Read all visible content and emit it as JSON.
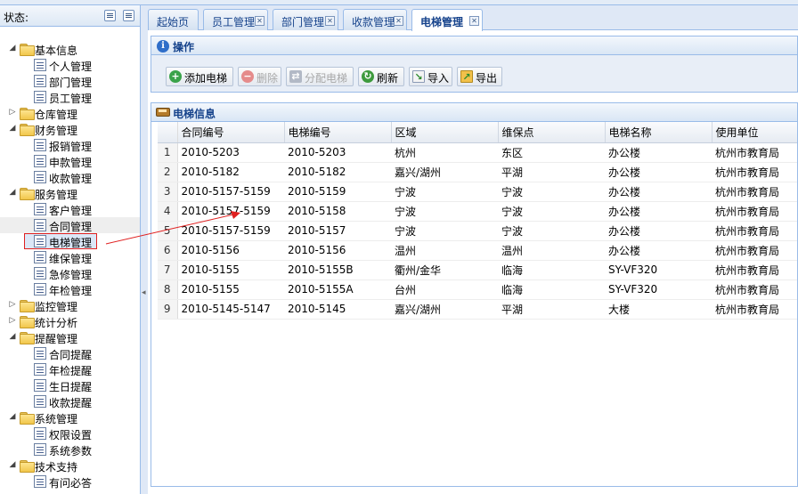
{
  "left_panel": {
    "title": "状态:"
  },
  "tree": [
    {
      "label": "基本信息",
      "level": 0,
      "expanded": true
    },
    {
      "label": "个人管理",
      "level": 1
    },
    {
      "label": "部门管理",
      "level": 1
    },
    {
      "label": "员工管理",
      "level": 1
    },
    {
      "label": "仓库管理",
      "level": 0,
      "expanded": false
    },
    {
      "label": "财务管理",
      "level": 0,
      "expanded": true
    },
    {
      "label": "报销管理",
      "level": 1
    },
    {
      "label": "申款管理",
      "level": 1
    },
    {
      "label": "收款管理",
      "level": 1
    },
    {
      "label": "服务管理",
      "level": 0,
      "expanded": true
    },
    {
      "label": "客户管理",
      "level": 1
    },
    {
      "label": "合同管理",
      "level": 1
    },
    {
      "label": "电梯管理",
      "level": 1,
      "selected": true
    },
    {
      "label": "维保管理",
      "level": 1
    },
    {
      "label": "急修管理",
      "level": 1
    },
    {
      "label": "年检管理",
      "level": 1
    },
    {
      "label": "监控管理",
      "level": 0,
      "expanded": false
    },
    {
      "label": "统计分析",
      "level": 0,
      "expanded": false
    },
    {
      "label": "提醒管理",
      "level": 0,
      "expanded": true
    },
    {
      "label": "合同提醒",
      "level": 1
    },
    {
      "label": "年检提醒",
      "level": 1
    },
    {
      "label": "生日提醒",
      "level": 1
    },
    {
      "label": "收款提醒",
      "level": 1
    },
    {
      "label": "系统管理",
      "level": 0,
      "expanded": true
    },
    {
      "label": "权限设置",
      "level": 1
    },
    {
      "label": "系统参数",
      "level": 1
    },
    {
      "label": "技术支持",
      "level": 0,
      "expanded": true
    },
    {
      "label": "有问必答",
      "level": 1
    }
  ],
  "tabs": [
    {
      "label": "起始页",
      "closable": false
    },
    {
      "label": "员工管理",
      "closable": true
    },
    {
      "label": "部门管理",
      "closable": true
    },
    {
      "label": "收款管理",
      "closable": true
    },
    {
      "label": "电梯管理",
      "closable": true,
      "active": true
    }
  ],
  "ops_panel": {
    "title": "操作",
    "buttons": [
      {
        "label": "添加电梯",
        "icon": "add-icon",
        "enabled": true
      },
      {
        "label": "删除",
        "icon": "delete-icon",
        "enabled": false
      },
      {
        "label": "分配电梯",
        "icon": "assign-icon",
        "enabled": false
      },
      {
        "label": "刷新",
        "icon": "refresh-icon",
        "enabled": true
      },
      {
        "label": "导入",
        "icon": "import-icon",
        "enabled": true
      },
      {
        "label": "导出",
        "icon": "export-icon",
        "enabled": true
      }
    ]
  },
  "grid": {
    "title": "电梯信息",
    "columns": [
      "合同编号",
      "电梯编号",
      "区域",
      "维保点",
      "电梯名称",
      "使用单位"
    ],
    "rows": [
      [
        "1",
        "2010-5203",
        "2010-5203",
        "杭州",
        "东区",
        "办公楼",
        "杭州市教育局"
      ],
      [
        "2",
        "2010-5182",
        "2010-5182",
        "嘉兴/湖州",
        "平湖",
        "办公楼",
        "杭州市教育局"
      ],
      [
        "3",
        "2010-5157-5159",
        "2010-5159",
        "宁波",
        "宁波",
        "办公楼",
        "杭州市教育局"
      ],
      [
        "4",
        "2010-5157-5159",
        "2010-5158",
        "宁波",
        "宁波",
        "办公楼",
        "杭州市教育局"
      ],
      [
        "5",
        "2010-5157-5159",
        "2010-5157",
        "宁波",
        "宁波",
        "办公楼",
        "杭州市教育局"
      ],
      [
        "6",
        "2010-5156",
        "2010-5156",
        "温州",
        "温州",
        "办公楼",
        "杭州市教育局"
      ],
      [
        "7",
        "2010-5155",
        "2010-5155B",
        "衢州/金华",
        "临海",
        "SY-VF320",
        "杭州市教育局"
      ],
      [
        "8",
        "2010-5155",
        "2010-5155A",
        "台州",
        "临海",
        "SY-VF320",
        "杭州市教育局"
      ],
      [
        "9",
        "2010-5145-5147",
        "2010-5145",
        "嘉兴/湖州",
        "平湖",
        "大楼",
        "杭州市教育局"
      ]
    ]
  },
  "colors": {
    "accent": "#15428b",
    "border": "#99bbe8",
    "annotation": "#e02020"
  }
}
